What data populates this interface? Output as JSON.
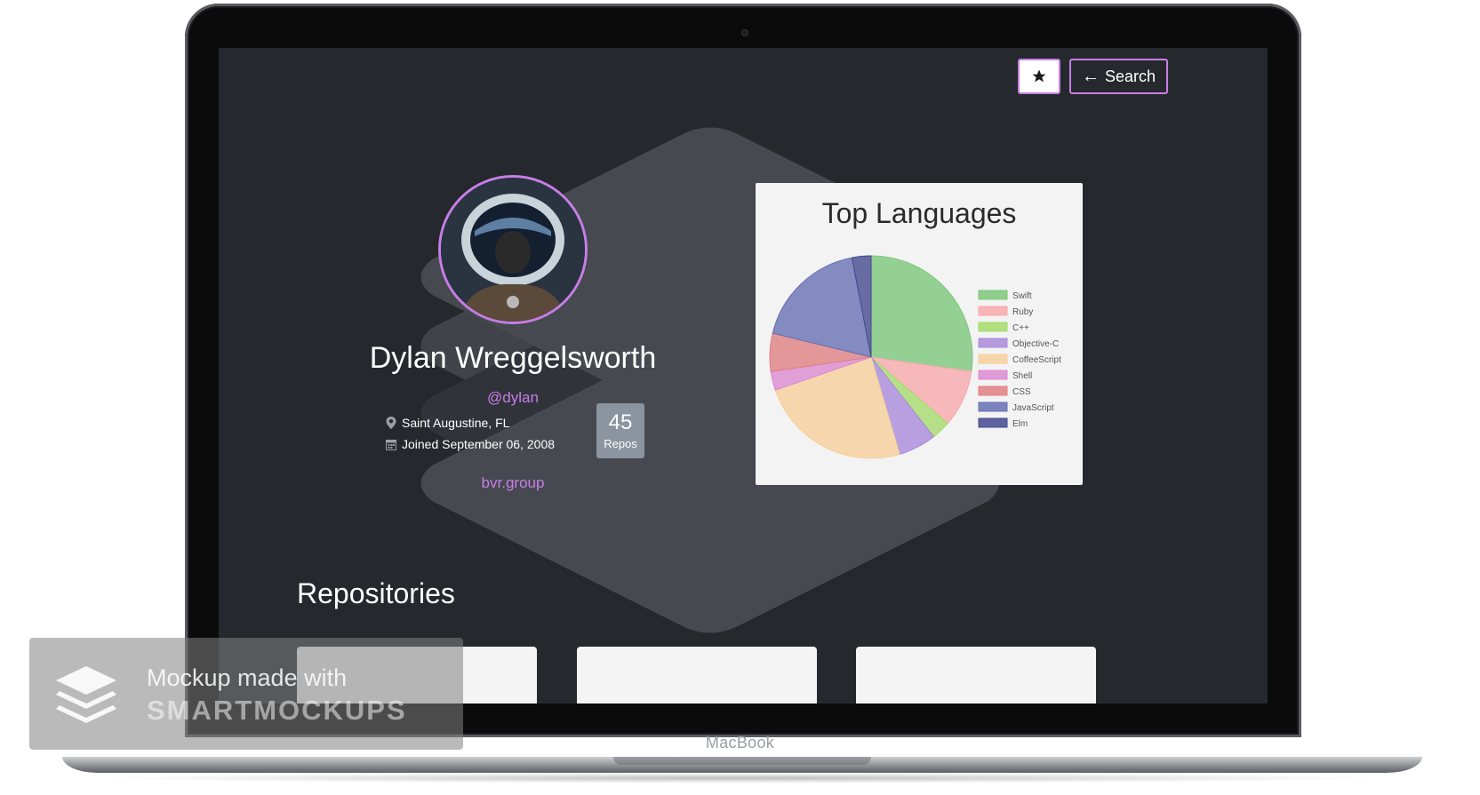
{
  "device": {
    "label": "MacBook"
  },
  "toolbar": {
    "star_icon": "star-icon",
    "search_label": "Search",
    "back_icon": "arrow-left-icon"
  },
  "profile": {
    "name": "Dylan Wreggelsworth",
    "handle": "@dylan",
    "location": "Saint Augustine, FL",
    "joined": "Joined September 06, 2008",
    "repos_count": "45",
    "repos_label": "Repos",
    "website": "bvr.group"
  },
  "chart_data": {
    "type": "pie",
    "title": "Top Languages",
    "legend_position": "right",
    "categories": [
      "Swift",
      "Ruby",
      "C++",
      "Objective-C",
      "CoffeeScript",
      "Shell",
      "CSS",
      "JavaScript",
      "Elm"
    ],
    "values": [
      9,
      3,
      1,
      2,
      8,
      1,
      2,
      6,
      1
    ],
    "colors": [
      "#7cc77a",
      "#f8a9ad",
      "#a6db6b",
      "#a98ad9",
      "#f6cf9b",
      "#dc8ad0",
      "#e07f82",
      "#6670b3",
      "#444a8e"
    ]
  },
  "repositories": {
    "heading": "Repositories"
  },
  "watermark": {
    "line1": "Mockup made with",
    "line2": "SMARTMOCKUPS"
  },
  "colors": {
    "accent": "#c77ee6",
    "screen_bg": "#25282c"
  }
}
